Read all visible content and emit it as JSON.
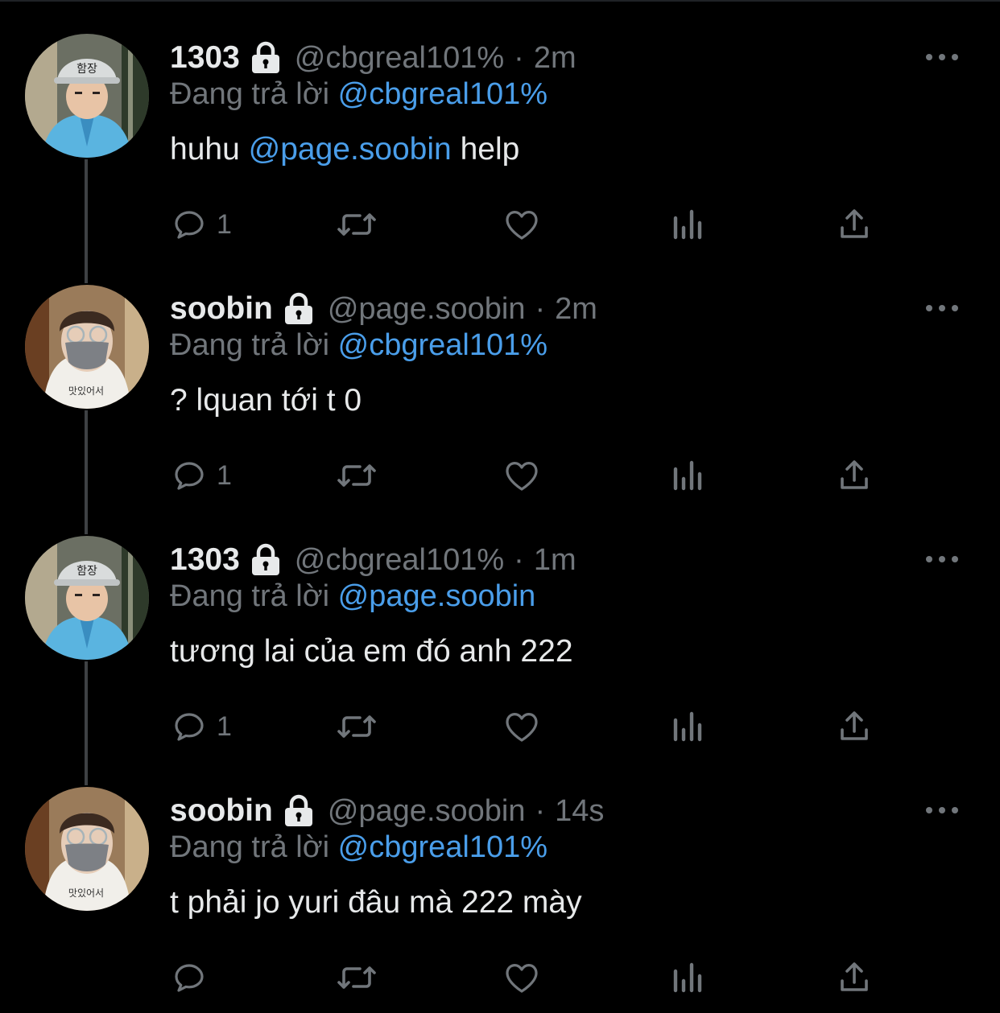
{
  "colors": {
    "background": "#000000",
    "text_primary": "#e7e9ea",
    "text_secondary": "#71767b",
    "mention": "#4a9eea",
    "thread_line": "#3e4144"
  },
  "tweets": [
    {
      "display_name": "1303",
      "handle": "@cbgreal101%",
      "separator": "·",
      "time": "2m",
      "reply_prefix": "Đang trả lời",
      "reply_to": "@cbgreal101%",
      "text_before": "huhu",
      "text_mention": "@page.soobin",
      "text_after": "help",
      "reply_count": "1",
      "avatar": "child-helmet-avatar",
      "avatar_text": "함장"
    },
    {
      "display_name": "soobin",
      "handle": "@page.soobin",
      "separator": "·",
      "time": "2m",
      "reply_prefix": "Đang trả lời",
      "reply_to": "@cbgreal101%",
      "text_before": "? lquan tới t 0",
      "text_mention": "",
      "text_after": "",
      "reply_count": "1",
      "avatar": "masked-person-avatar",
      "avatar_text": "맛있어서"
    },
    {
      "display_name": "1303",
      "handle": "@cbgreal101%",
      "separator": "·",
      "time": "1m",
      "reply_prefix": "Đang trả lời",
      "reply_to": "@page.soobin",
      "text_before": "tương lai của em đó anh 222",
      "text_mention": "",
      "text_after": "",
      "reply_count": "1",
      "avatar": "child-helmet-avatar",
      "avatar_text": "함장"
    },
    {
      "display_name": "soobin",
      "handle": "@page.soobin",
      "separator": "·",
      "time": "14s",
      "reply_prefix": "Đang trả lời",
      "reply_to": "@cbgreal101%",
      "text_before": "t phải jo yuri đâu mà 222 mày",
      "text_mention": "",
      "text_after": "",
      "reply_count": "",
      "avatar": "masked-person-avatar",
      "avatar_text": "맛있어서"
    }
  ]
}
